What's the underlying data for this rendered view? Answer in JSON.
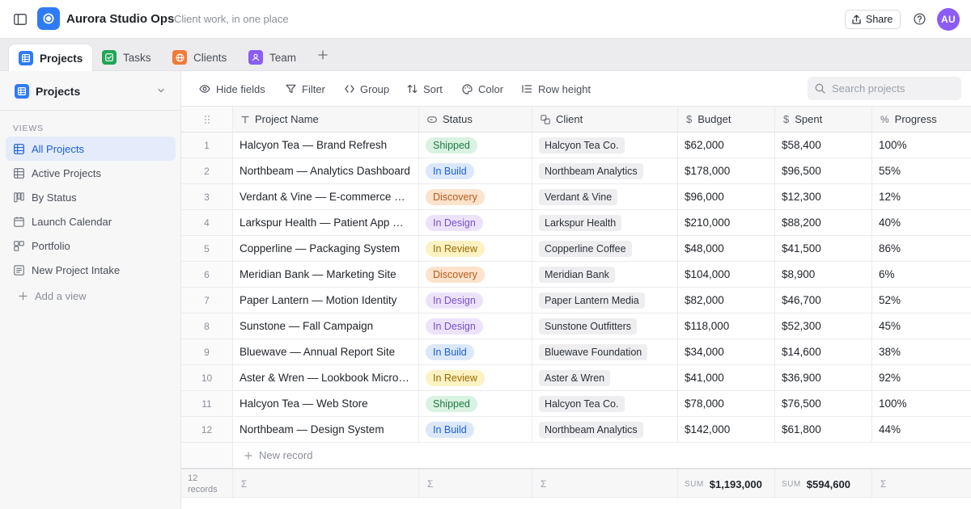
{
  "app": {
    "title": "Aurora Studio Ops",
    "subtitle": "Client work, in one place",
    "share_label": "Share",
    "avatar_initials": "AU",
    "accent": "#2f7bf5"
  },
  "tabs": [
    {
      "label": "Projects",
      "icon": "grid-icon",
      "color": "#2f7bf5",
      "active": true
    },
    {
      "label": "Tasks",
      "icon": "checkbox-icon",
      "color": "#22a559"
    },
    {
      "label": "Clients",
      "icon": "globe-icon",
      "color": "#f07a3a"
    },
    {
      "label": "Team",
      "icon": "person-icon",
      "color": "#8b5cf6"
    }
  ],
  "sidebar": {
    "title": "Projects",
    "section_label": "VIEWS",
    "views": [
      {
        "label": "All Projects",
        "icon": "grid-view-icon",
        "active": true
      },
      {
        "label": "Active Projects",
        "icon": "grid-view-icon"
      },
      {
        "label": "By Status",
        "icon": "kanban-icon"
      },
      {
        "label": "Launch Calendar",
        "icon": "calendar-icon"
      },
      {
        "label": "Portfolio",
        "icon": "gallery-icon"
      },
      {
        "label": "New Project Intake",
        "icon": "form-icon"
      }
    ],
    "add_view_label": "Add a view"
  },
  "toolbar": {
    "hide_fields": "Hide fields",
    "filter": "Filter",
    "group": "Group",
    "sort": "Sort",
    "color": "Color",
    "row_height": "Row height",
    "search_placeholder": "Search projects"
  },
  "columns": {
    "name": "Project Name",
    "status": "Status",
    "client": "Client",
    "budget": "Budget",
    "spent": "Spent",
    "progress": "Progress"
  },
  "status_colors": {
    "Shipped": {
      "bg": "#d9f2e1",
      "fg": "#1e7a43"
    },
    "In Build": {
      "bg": "#dbe8fb",
      "fg": "#1d5fd6"
    },
    "Discovery": {
      "bg": "#fde2cc",
      "fg": "#b9591a"
    },
    "In Design": {
      "bg": "#ece3fb",
      "fg": "#7a4ed1"
    },
    "In Review": {
      "bg": "#fdf2c4",
      "fg": "#9a6b00"
    }
  },
  "rows": [
    {
      "num": "1",
      "name": "Halcyon Tea — Brand Refresh",
      "status": "Shipped",
      "client": "Halcyon Tea Co.",
      "budget": "$62,000",
      "spent": "$58,400",
      "progress": "100%"
    },
    {
      "num": "2",
      "name": "Northbeam — Analytics Dashboard",
      "status": "In Build",
      "client": "Northbeam Analytics",
      "budget": "$178,000",
      "spent": "$96,500",
      "progress": "55%"
    },
    {
      "num": "3",
      "name": "Verdant & Vine — E-commerce Replatform",
      "status": "Discovery",
      "client": "Verdant & Vine",
      "budget": "$96,000",
      "spent": "$12,300",
      "progress": "12%"
    },
    {
      "num": "4",
      "name": "Larkspur Health — Patient App Redesign",
      "status": "In Design",
      "client": "Larkspur Health",
      "budget": "$210,000",
      "spent": "$88,200",
      "progress": "40%"
    },
    {
      "num": "5",
      "name": "Copperline — Packaging System",
      "status": "In Review",
      "client": "Copperline Coffee",
      "budget": "$48,000",
      "spent": "$41,500",
      "progress": "86%"
    },
    {
      "num": "6",
      "name": "Meridian Bank — Marketing Site",
      "status": "Discovery",
      "client": "Meridian Bank",
      "budget": "$104,000",
      "spent": "$8,900",
      "progress": "6%"
    },
    {
      "num": "7",
      "name": "Paper Lantern — Motion Identity",
      "status": "In Design",
      "client": "Paper Lantern Media",
      "budget": "$82,000",
      "spent": "$46,700",
      "progress": "52%"
    },
    {
      "num": "8",
      "name": "Sunstone — Fall Campaign",
      "status": "In Design",
      "client": "Sunstone Outfitters",
      "budget": "$118,000",
      "spent": "$52,300",
      "progress": "45%"
    },
    {
      "num": "9",
      "name": "Bluewave — Annual Report Site",
      "status": "In Build",
      "client": "Bluewave Foundation",
      "budget": "$34,000",
      "spent": "$14,600",
      "progress": "38%"
    },
    {
      "num": "10",
      "name": "Aster & Wren — Lookbook Microsite",
      "status": "In Review",
      "client": "Aster & Wren",
      "budget": "$41,000",
      "spent": "$36,900",
      "progress": "92%"
    },
    {
      "num": "11",
      "name": "Halcyon Tea — Web Store",
      "status": "Shipped",
      "client": "Halcyon Tea Co.",
      "budget": "$78,000",
      "spent": "$76,500",
      "progress": "100%"
    },
    {
      "num": "12",
      "name": "Northbeam — Design System",
      "status": "In Build",
      "client": "Northbeam Analytics",
      "budget": "$142,000",
      "spent": "$61,800",
      "progress": "44%"
    }
  ],
  "new_record_label": "New record",
  "footer": {
    "count_num": "12",
    "count_label": "records",
    "sigma": "Σ",
    "sum_label": "SUM",
    "budget_sum": "$1,193,000",
    "spent_sum": "$594,600"
  }
}
